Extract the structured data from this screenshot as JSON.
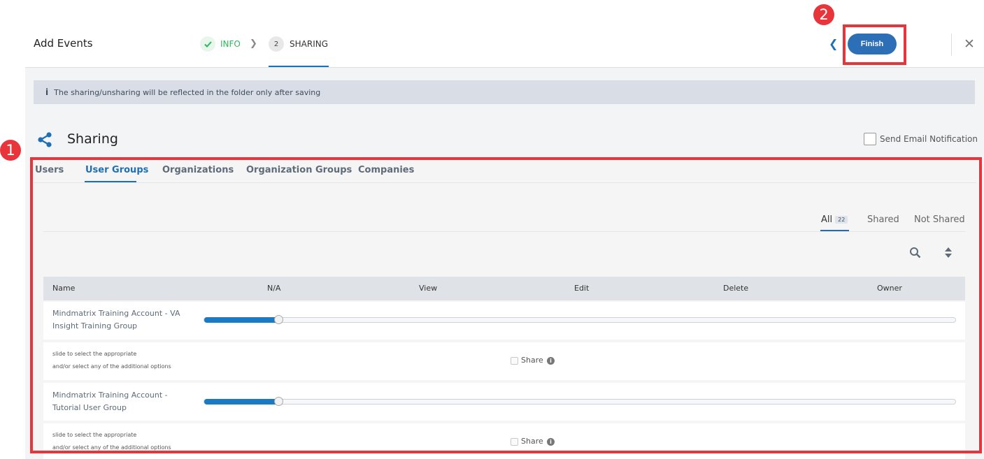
{
  "header": {
    "title": "Add Events",
    "steps": [
      {
        "label": "INFO",
        "number": "✓",
        "state": "done"
      },
      {
        "label": "SHARING",
        "number": "2",
        "state": "active"
      }
    ],
    "finish_label": "Finish"
  },
  "annotations": {
    "badge1": "1",
    "badge2": "2"
  },
  "info_message": "The sharing/unsharing will be reflected in the folder only after saving",
  "section": {
    "title": "Sharing",
    "email_notification_label": "Send Email Notification"
  },
  "tabs": [
    "Users",
    "User Groups",
    "Organizations",
    "Organization Groups",
    "Companies"
  ],
  "active_tab": "User Groups",
  "filters": {
    "all": "All",
    "all_count": "22",
    "shared": "Shared",
    "not_shared": "Not Shared"
  },
  "table": {
    "columns": [
      "Name",
      "N/A",
      "View",
      "Edit",
      "Delete",
      "Owner"
    ],
    "rows": [
      {
        "name_line1": "Mindmatrix Training Account - VA",
        "name_line2": "Insight Training Group",
        "slider_level": 0,
        "hint_line1": "slide to select the appropriate",
        "hint_line2": "and/or select any of the additional options",
        "share_label": "Share"
      },
      {
        "name_line1": "Mindmatrix Training Account -",
        "name_line2": "Tutorial User Group",
        "slider_level": 0,
        "hint_line1": "slide to select the appropriate",
        "hint_line2": "and/or select any of the additional options",
        "share_label": "Share"
      }
    ]
  },
  "colors": {
    "accent": "#1f6fb5",
    "highlight": "#e8343b",
    "success": "#2eb85c"
  }
}
